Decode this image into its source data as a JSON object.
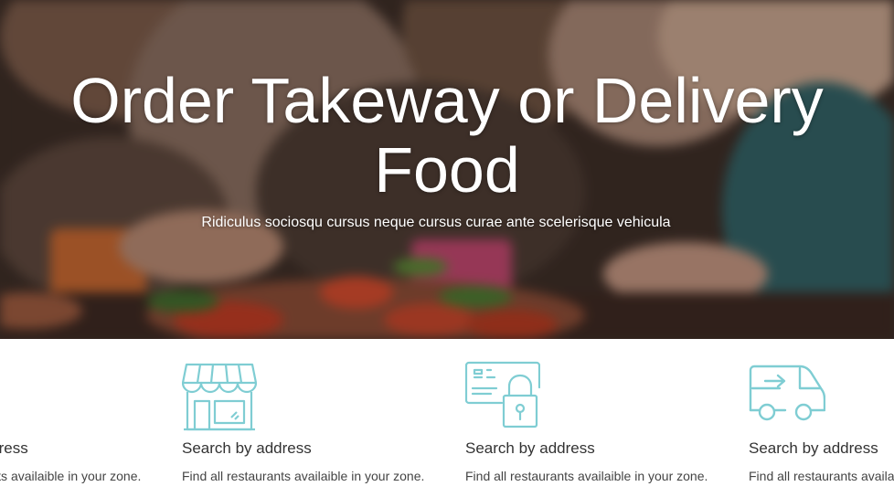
{
  "hero": {
    "title": "Order Takeway or Delivery Food",
    "subtitle": "Ridiculus sociosqu cursus neque cursus curae ante scelerisque vehicula"
  },
  "features": [
    {
      "icon": "pin-icon",
      "title": "Search by address",
      "text": "Find all restaurants availaible in your zone."
    },
    {
      "icon": "store-icon",
      "title": "Search by address",
      "text": "Find all restaurants availaible in your zone."
    },
    {
      "icon": "secure-card-icon",
      "title": "Search by address",
      "text": "Find all restaurants availaible in your zone."
    },
    {
      "icon": "delivery-van-icon",
      "title": "Search by address",
      "text": "Find all restaurants availaible in your zone."
    }
  ],
  "colors": {
    "accent": "#7fcdd3",
    "text": "#333333"
  }
}
